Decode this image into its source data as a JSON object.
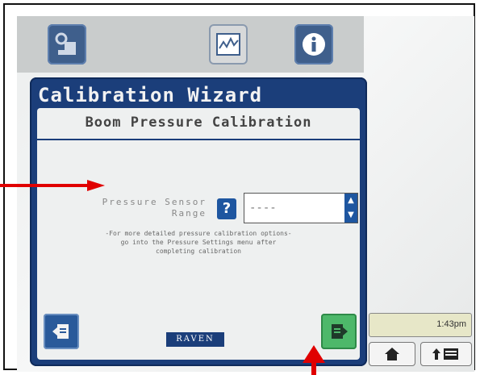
{
  "wizard": {
    "title": "Calibration Wizard",
    "subtitle": "Boom Pressure Calibration",
    "sensor_label_line1": "Pressure Sensor",
    "sensor_label_line2": "Range",
    "help_label": "?",
    "field_value": "----",
    "note_line1": "-For more detailed pressure calibration options-",
    "note_line2": "go into the Pressure Settings menu after",
    "note_line3": "completing calibration",
    "logo_text": "RAVEN"
  },
  "status": {
    "time": "1:43pm"
  },
  "colors": {
    "wizard_blue": "#1b3e7a",
    "next_green": "#4db86a",
    "annotation_red": "#e00000"
  },
  "icons": {
    "top_buttons": [
      "machine-settings-icon",
      "chart-icon",
      "info-icon"
    ],
    "nav": [
      "back-arrow-icon",
      "next-arrow-icon",
      "home-icon",
      "menu-icon"
    ]
  }
}
